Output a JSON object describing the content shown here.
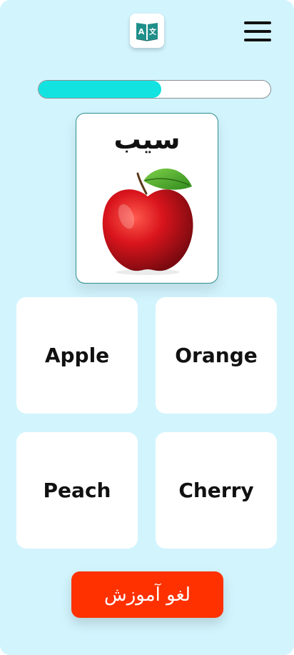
{
  "header": {
    "logo_icon": "translate-book-icon",
    "logo_letter_latin": "A",
    "logo_letter_cjk": "文",
    "menu_icon": "hamburger-menu-icon"
  },
  "progress": {
    "fraction": 0.53
  },
  "word_card": {
    "word": "سیب",
    "image": "red-apple-icon"
  },
  "options": [
    {
      "label": "Apple"
    },
    {
      "label": "Orange"
    },
    {
      "label": "Peach"
    },
    {
      "label": "Cherry"
    }
  ],
  "cancel_button": {
    "label": "لغو آموزش"
  },
  "colors": {
    "background": "#d2f4fd",
    "progress_fill": "#12e3e0",
    "cancel_button": "#ff3100",
    "card_border": "#2a8f8f",
    "logo_teal": "#1f8f8a"
  }
}
